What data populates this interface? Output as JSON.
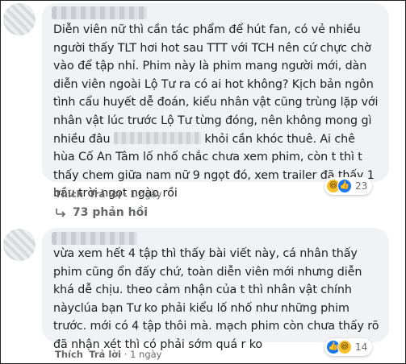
{
  "comments": [
    {
      "lines": [
        "Diễn viên nữ thì cần tác phẩm để hút fan, có vẻ nhiều",
        "người thấy TLT hơi hot sau TTT với TCH nên cứ chực chờ",
        "vào để tập nhỉ. Phim này là phim mang người mới, dàn",
        "diễn viên ngoài Lộ Tư ra có ai hot không? Kịch bản ngôn",
        "tình cẩu huyết dễ đoán, kiểu nhân vật cũng trùng lặp với",
        "nhân vật lúc trước Lộ Tư từng đóng, nên không mong gì",
        "nhiều đâu",
        "khỏi cần khóc thuê. Ai chê",
        "hùa Cố An Tâm lố nhố chắc chưa xem phim, còn t thì t",
        "thấy chem giữa nam nữ 9 ngọt đó, xem trailer đã thấy 1",
        "bầu trời ngọt ngào rồi"
      ],
      "like_label": "Thích",
      "reply_label": "Trả lời",
      "separator": "·",
      "time": "1 ngày",
      "reaction_count": "23",
      "reactions": [
        "haha-icon",
        "like-icon"
      ]
    },
    {
      "lines": [
        "vừa xem hết 4 tập thì thấy bài viết này, cá nhân thấy",
        "phim cũng ổn đấy chứ, toàn diễn viên mới nhưng diễn",
        "khá dễ chịu. theo cảm nhận của t thì nhân vật chính",
        "nàyclúa bạn Tư ko phải kiểu lố nhố như những phim",
        "trước. mới có 4 tập thôi mà. mạch phim còn chưa thấy rõ",
        "đã nhận xét thì có phải sớm quá r ko"
      ],
      "like_label": "Thích",
      "reply_label": "Trả lời",
      "separator": "·",
      "time": "1 ngày",
      "reaction_count": "14",
      "reactions": [
        "like-icon",
        "haha-icon"
      ]
    }
  ],
  "replies_label": "73 phản hồi",
  "colors": {
    "bubble": "#f0f2f5",
    "meta": "#65676b",
    "like": "#1877f2",
    "haha": "#f7c02b"
  }
}
